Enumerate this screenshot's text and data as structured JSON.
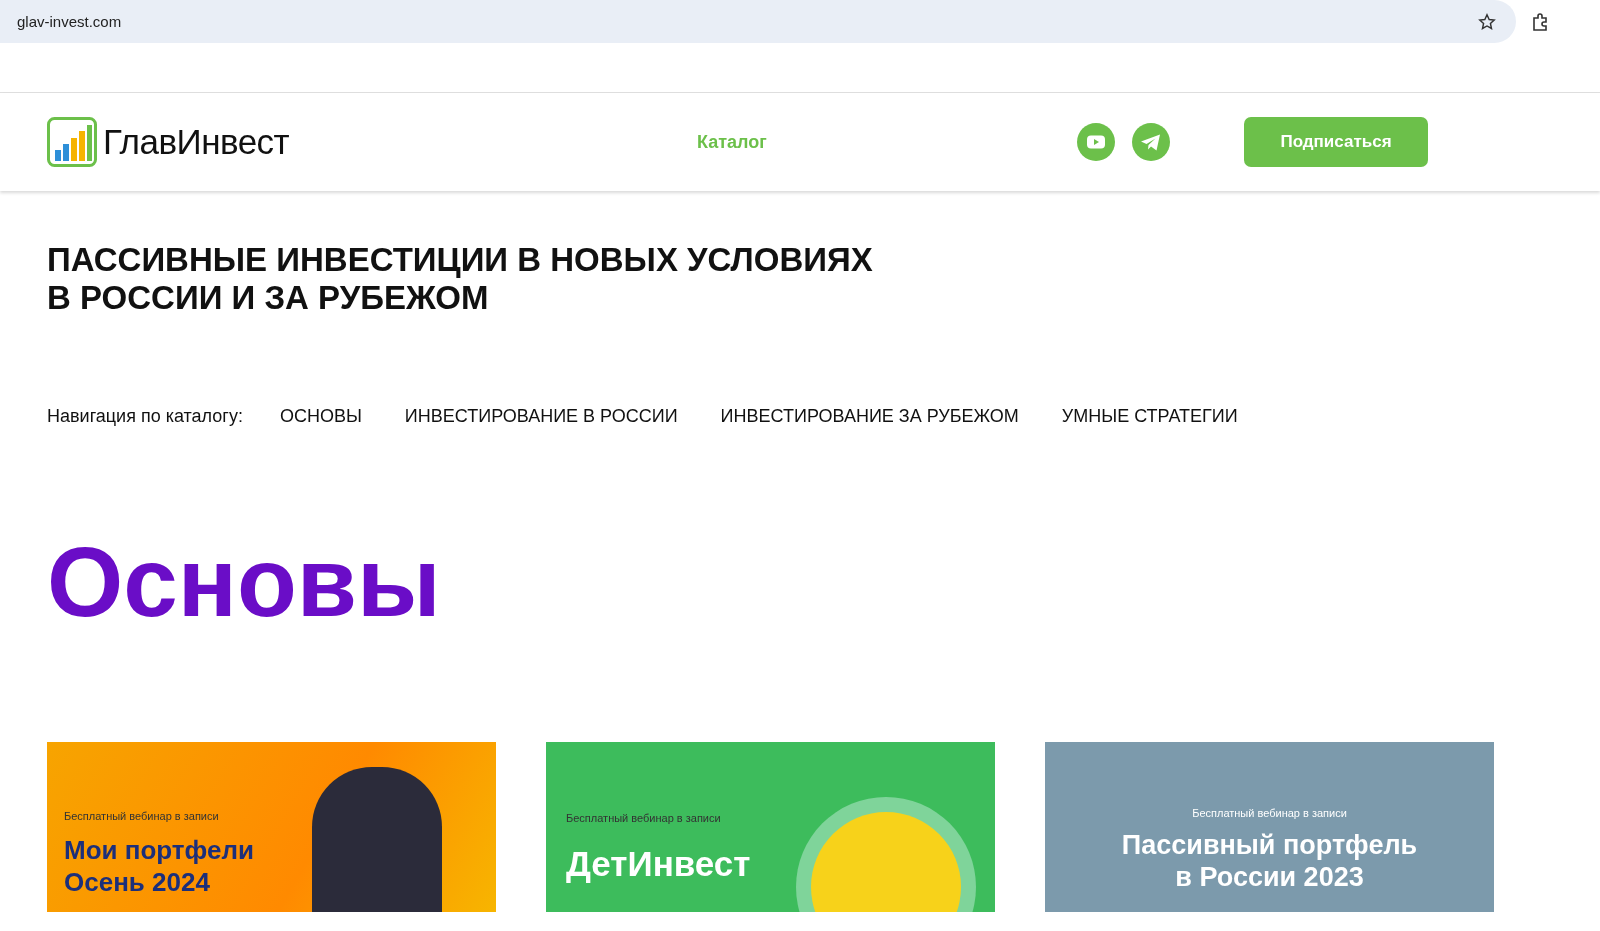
{
  "browser": {
    "url": "glav-invest.com"
  },
  "header": {
    "logo": "ГлавИнвест",
    "nav_link": "Каталог",
    "subscribe_button": "Подписаться"
  },
  "headline": [
    "ПАССИВНЫЕ ИНВЕСТИЦИИ В НОВЫХ УСЛОВИЯХ",
    "В РОССИИ И ЗА РУБЕЖОМ"
  ],
  "catalog_nav": {
    "label": "Навигация по каталогу:",
    "links": [
      "ОСНОВЫ",
      "ИНВЕСТИРОВАНИЕ В РОССИИ",
      "ИНВЕСТИРОВАНИЕ ЗА РУБЕЖОМ",
      "УМНЫЕ СТРАТЕГИИ"
    ]
  },
  "section_title": "Основы",
  "cards": [
    {
      "kind": "orange",
      "caption": "Бесплатный вебинар в записи",
      "title": [
        "Мои портфели",
        "Осень 2024"
      ]
    },
    {
      "kind": "green",
      "caption": "Бесплатный вебинар в записи",
      "title": [
        "ДетИнвест"
      ]
    },
    {
      "kind": "slate",
      "caption": "Бесплатный вебинар в записи",
      "title": [
        "Пассивный портфель",
        "в России 2023"
      ]
    }
  ]
}
